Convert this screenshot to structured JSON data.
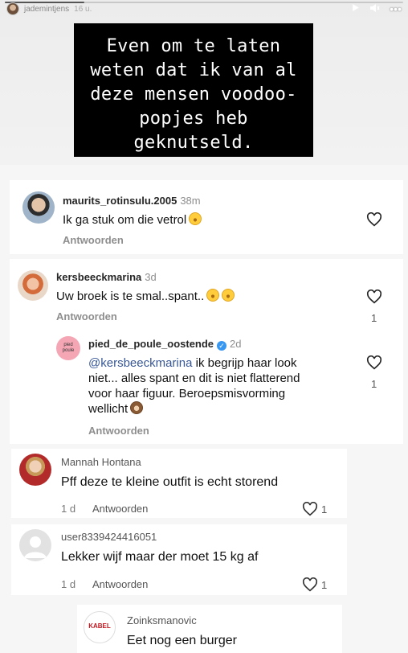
{
  "story": {
    "username": "jademintjens",
    "time": "16 u.",
    "progress": 0.2,
    "icons": [
      "play-icon",
      "mute-icon",
      "more-icon"
    ]
  },
  "caption": {
    "lines": [
      "Even om te laten",
      "weten dat ik van al",
      "deze mensen voodoo-",
      "popjes heb",
      "geknutseld."
    ]
  },
  "comments": [
    {
      "username": "maurits_rotinsulu.2005",
      "time": "38m",
      "text": "Ik ga stuk om die vetrol",
      "reply_label": "Antwoorden"
    },
    {
      "username": "kersbeeckmarina",
      "time": "3d",
      "text": "Uw broek is te smal..spant..",
      "reply_label": "Antwoorden",
      "likes": "1"
    },
    {
      "username": "pied_de_poule_oostende",
      "time": "2d",
      "mention": "@kersbeeckmarina",
      "text_lines": [
        " ik begrijp haar look",
        "niet... alles spant en dit is niet flatterend",
        "voor haar figuur. Beroepsmisvorming",
        "wellicht"
      ],
      "reply_label": "Antwoorden",
      "likes": "1"
    }
  ],
  "fb_comments": [
    {
      "name": "Mannah Hontana",
      "text": "Pff deze te kleine outfit is echt storend",
      "time": "1 d",
      "reply_label": "Antwoorden",
      "likes": "1"
    },
    {
      "name": "user8339424416051",
      "text": "Lekker wijf maar der moet 15 kg af",
      "time": "1 d",
      "reply_label": "Antwoorden",
      "likes": "1"
    },
    {
      "name": "Zoinksmanovic",
      "text": "Eet nog een burger",
      "avatar_text": "KABEL"
    }
  ]
}
